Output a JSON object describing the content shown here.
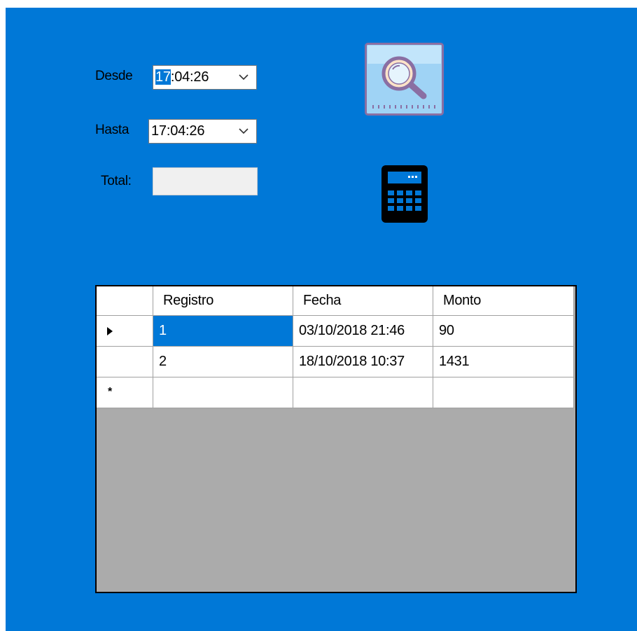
{
  "form": {
    "background": "#0078d7",
    "desde": {
      "label": "Desde",
      "value_selected": "17",
      "value_rest": ":04:26"
    },
    "hasta": {
      "label": "Hasta",
      "value": "17:04:26"
    },
    "total": {
      "label": "Total:",
      "value": ""
    },
    "icons": {
      "search": "search-icon",
      "calculator": "calculator-icon",
      "dropdown": "chevron-down-icon"
    }
  },
  "grid": {
    "columns": [
      "Registro",
      "Fecha",
      "Monto"
    ],
    "rows": [
      {
        "registro": "1",
        "fecha": "03/10/2018 21:46",
        "monto": "90",
        "current": true
      },
      {
        "registro": "2",
        "fecha": "18/10/2018 10:37",
        "monto": "1431",
        "current": false
      }
    ],
    "new_row_marker": "*",
    "selection_color": "#0078d7",
    "empty_area_color": "#ababab"
  }
}
